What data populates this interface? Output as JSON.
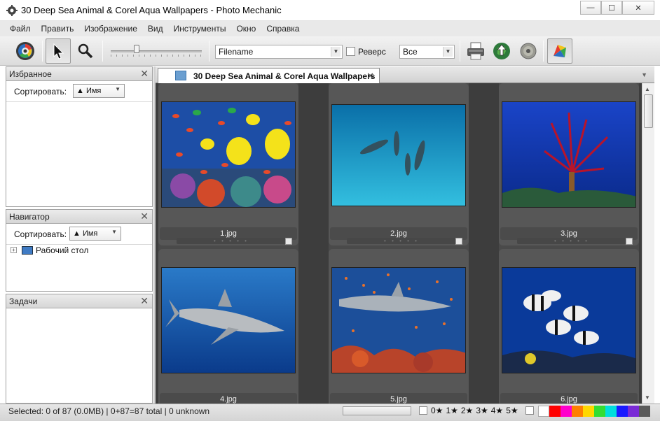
{
  "window": {
    "title": "30 Deep Sea Animal & Corel Aqua Wallpapers - Photo Mechanic",
    "controls": {
      "minimize": "—",
      "maximize": "☐",
      "close": "✕"
    }
  },
  "menu": [
    "Файл",
    "Править",
    "Изображение",
    "Вид",
    "Инструменты",
    "Окно",
    "Справка"
  ],
  "toolbar": {
    "sort_field": "Filename",
    "reverse_label": "Реверс",
    "reverse_checked": false,
    "filter_value": "Все",
    "icons": [
      "settings-icon",
      "pointer-icon",
      "zoom-icon",
      "print-icon",
      "upload-icon",
      "burn-disc-icon",
      "color-class-icon"
    ]
  },
  "panels": {
    "favorites": {
      "title": "Избранное",
      "sort_label": "Сортировать:",
      "sort_value": "Имя",
      "close": "✕"
    },
    "navigator": {
      "title": "Навигатор",
      "sort_label": "Сортировать:",
      "sort_value": "Имя",
      "close": "✕",
      "tree_root": "Рабочий стол",
      "tree_expander": "+"
    },
    "tasks": {
      "title": "Задачи",
      "close": "✕"
    }
  },
  "tab": {
    "label": "30 Deep Sea Animal & Corel Aqua Wallpapers",
    "close": "✕"
  },
  "thumbnails": [
    {
      "name": "1.jpg",
      "scene": "tropical-fish"
    },
    {
      "name": "2.jpg",
      "scene": "dolphins"
    },
    {
      "name": "3.jpg",
      "scene": "crinoid"
    },
    {
      "name": "4.jpg",
      "scene": "shark"
    },
    {
      "name": "5.jpg",
      "scene": "shark-reef"
    },
    {
      "name": "6.jpg",
      "scene": "striped-fish"
    }
  ],
  "status": {
    "text": "Selected: 0 of 87 (0.0MB) | 0+87=87 total | 0 unknown",
    "star_filter": [
      "0★",
      "1★",
      "2★",
      "3★",
      "4★",
      "5★"
    ],
    "color_classes": [
      "#ffffff",
      "#ff0000",
      "#ff00cc",
      "#ff7f00",
      "#ffd800",
      "#33dd33",
      "#00dddd",
      "#1a1aff",
      "#7a2bd6",
      "#5a5a5a"
    ]
  },
  "colors": {
    "accent": "#2f6fb6",
    "grid_bg": "#3d3d3d",
    "cell_bg": "#575757"
  }
}
